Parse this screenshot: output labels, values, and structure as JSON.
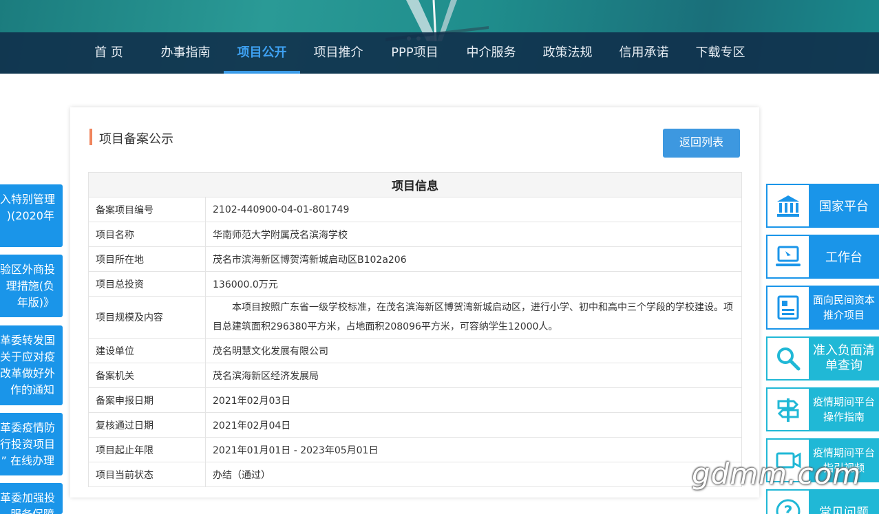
{
  "nav": {
    "items": [
      "首 页",
      "办事指南",
      "项目公开",
      "项目推介",
      "PPP项目",
      "中介服务",
      "政策法规",
      "信用承诺",
      "下载专区"
    ],
    "active": "项目公开"
  },
  "news": [
    [
      "入特别管理",
      ")(2020年"
    ],
    [
      "验区外商投",
      "理措施(负",
      "年版)》"
    ],
    [
      "革委转发国",
      "关于应对疫",
      "改革做好外",
      "作的通知"
    ],
    [
      "革委疫情防",
      "行投资项目",
      "” 在线办理"
    ],
    [
      "革委加强投",
      "服务保障"
    ]
  ],
  "card": {
    "title": "项目备案公示",
    "back_button": "返回列表",
    "table_title": "项目信息",
    "rows": [
      {
        "label": "备案项目编号",
        "value": "2102-440900-04-01-801749"
      },
      {
        "label": "项目名称",
        "value": "华南师范大学附属茂名滨海学校"
      },
      {
        "label": "项目所在地",
        "value": "茂名市滨海新区博贺湾新城启动区B102a206"
      },
      {
        "label": "项目总投资",
        "value": "136000.0万元"
      },
      {
        "label": "项目规模及内容",
        "value": "本项目按照广东省一级学校标准，在茂名滨海新区博贺湾新城启动区，进行小学、初中和高中三个学段的学校建设。项目总建筑面积296380平方米，占地面积208096平方米，可容纳学生12000人。"
      },
      {
        "label": "建设单位",
        "value": "茂名明慧文化发展有限公司"
      },
      {
        "label": "备案机关",
        "value": "茂名滨海新区经济发展局"
      },
      {
        "label": "备案申报日期",
        "value": "2021年02月03日"
      },
      {
        "label": "复核通过日期",
        "value": "2021年02月04日"
      },
      {
        "label": "项目起止年限",
        "value": "2021年01月01日 - 2023年05月01日"
      },
      {
        "label": "项目当前状态",
        "value": "办结（通过）"
      }
    ]
  },
  "sidebar": {
    "items": [
      {
        "label": "国家平台",
        "icon": "bank-icon"
      },
      {
        "label": "工作台",
        "icon": "computer-icon"
      },
      {
        "label": "面向民间资本推介项目",
        "icon": "document-icon"
      },
      {
        "label": "准入负面清单查询",
        "icon": "search-icon"
      },
      {
        "label": "疫情期间平台操作指南",
        "icon": "signpost-icon"
      },
      {
        "label": "疫情期间平台指引视频",
        "icon": "video-icon"
      },
      {
        "label": "常见问题",
        "icon": "question-icon"
      }
    ],
    "colors": {
      "blue": "#1a95e9",
      "cyan": "#20b8d6"
    }
  },
  "watermark": "gdmm.com"
}
